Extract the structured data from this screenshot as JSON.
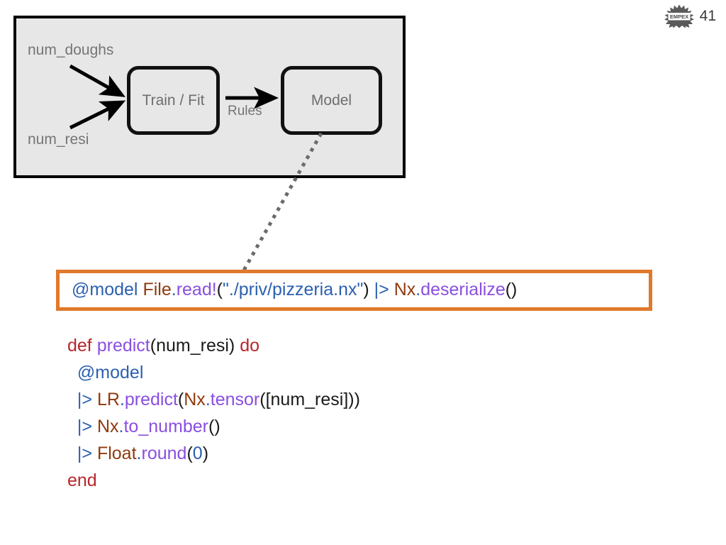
{
  "brand": {
    "logo_text": "EMPEX",
    "logo_icon": "starburst-icon",
    "page_number": "41"
  },
  "diagram": {
    "inputs": [
      {
        "label": "num_doughs"
      },
      {
        "label": "num_resi"
      }
    ],
    "nodes": [
      {
        "id": "train",
        "label": "Train / Fit"
      },
      {
        "id": "model",
        "label": "Model"
      }
    ],
    "edge_label": "Rules"
  },
  "highlight_code": {
    "border_color": "#E0792B",
    "tokens": [
      {
        "text": "@model",
        "cls": "tok-attr"
      },
      {
        "text": " ",
        "cls": "tok-plain"
      },
      {
        "text": "File",
        "cls": "tok-mod"
      },
      {
        "text": ".",
        "cls": "tok-dot"
      },
      {
        "text": "read!",
        "cls": "tok-fn"
      },
      {
        "text": "(",
        "cls": "tok-plain"
      },
      {
        "text": "\"./priv/pizzeria.nx\"",
        "cls": "tok-str"
      },
      {
        "text": ")",
        "cls": "tok-plain"
      },
      {
        "text": " ",
        "cls": "tok-plain"
      },
      {
        "text": "|>",
        "cls": "tok-pipe"
      },
      {
        "text": " ",
        "cls": "tok-plain"
      },
      {
        "text": "Nx",
        "cls": "tok-mod"
      },
      {
        "text": ".",
        "cls": "tok-dot"
      },
      {
        "text": "deserialize",
        "cls": "tok-fn"
      },
      {
        "text": "()",
        "cls": "tok-plain"
      }
    ],
    "plain_text": "@model File.read!(\"./priv/pizzeria.nx\") |> Nx.deserialize()"
  },
  "code_block": {
    "lines": [
      {
        "plain_text": "def predict(num_resi) do",
        "tokens": [
          {
            "text": "def",
            "cls": "tok-kw"
          },
          {
            "text": " ",
            "cls": "tok-plain"
          },
          {
            "text": "predict",
            "cls": "tok-fn"
          },
          {
            "text": "(num_resi)",
            "cls": "tok-plain"
          },
          {
            "text": " ",
            "cls": "tok-plain"
          },
          {
            "text": "do",
            "cls": "tok-kw"
          }
        ]
      },
      {
        "plain_text": "  @model",
        "tokens": [
          {
            "text": "  ",
            "cls": "tok-plain"
          },
          {
            "text": "@model",
            "cls": "tok-attr"
          }
        ]
      },
      {
        "plain_text": "  |> LR.predict(Nx.tensor([num_resi]))",
        "tokens": [
          {
            "text": "  ",
            "cls": "tok-plain"
          },
          {
            "text": "|>",
            "cls": "tok-pipe"
          },
          {
            "text": " ",
            "cls": "tok-plain"
          },
          {
            "text": "LR",
            "cls": "tok-mod"
          },
          {
            "text": ".",
            "cls": "tok-dot"
          },
          {
            "text": "predict",
            "cls": "tok-fn"
          },
          {
            "text": "(",
            "cls": "tok-plain"
          },
          {
            "text": "Nx",
            "cls": "tok-mod"
          },
          {
            "text": ".",
            "cls": "tok-dot"
          },
          {
            "text": "tensor",
            "cls": "tok-fn"
          },
          {
            "text": "([num_resi]))",
            "cls": "tok-plain"
          }
        ]
      },
      {
        "plain_text": "  |> Nx.to_number()",
        "tokens": [
          {
            "text": "  ",
            "cls": "tok-plain"
          },
          {
            "text": "|>",
            "cls": "tok-pipe"
          },
          {
            "text": " ",
            "cls": "tok-plain"
          },
          {
            "text": "Nx",
            "cls": "tok-mod"
          },
          {
            "text": ".",
            "cls": "tok-dot"
          },
          {
            "text": "to_number",
            "cls": "tok-fn"
          },
          {
            "text": "()",
            "cls": "tok-plain"
          }
        ]
      },
      {
        "plain_text": "  |> Float.round(0)",
        "tokens": [
          {
            "text": "  ",
            "cls": "tok-plain"
          },
          {
            "text": "|>",
            "cls": "tok-pipe"
          },
          {
            "text": " ",
            "cls": "tok-plain"
          },
          {
            "text": "Float",
            "cls": "tok-mod"
          },
          {
            "text": ".",
            "cls": "tok-dot"
          },
          {
            "text": "round",
            "cls": "tok-fn"
          },
          {
            "text": "(",
            "cls": "tok-plain"
          },
          {
            "text": "0",
            "cls": "tok-num"
          },
          {
            "text": ")",
            "cls": "tok-plain"
          }
        ]
      },
      {
        "plain_text": "end",
        "tokens": [
          {
            "text": "end",
            "cls": "tok-kw"
          }
        ]
      }
    ]
  },
  "colors": {
    "panel_background": "#e7e7e7",
    "panel_border": "#000000",
    "accent_orange": "#E0792B",
    "label_gray": "#757575",
    "keyword_red": "#B7262B",
    "function_purple": "#8A4FE0",
    "module_brown": "#8F3A0E",
    "string_blue": "#2B5FB0"
  }
}
